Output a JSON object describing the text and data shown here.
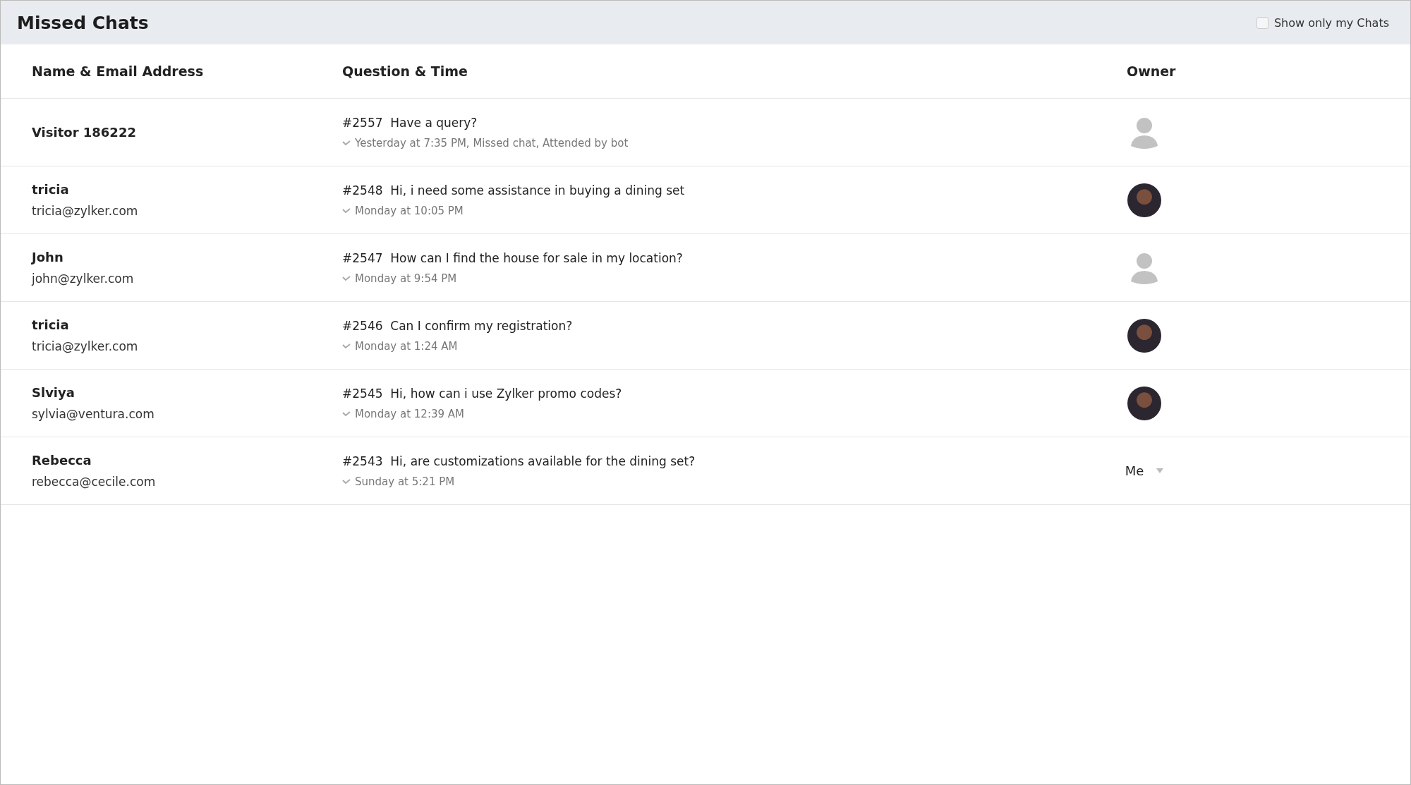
{
  "header": {
    "title": "Missed Chats",
    "filter": {
      "label": "Show only my Chats",
      "checked": false
    }
  },
  "table": {
    "columns": [
      "Name & Email Address",
      "Question & Time",
      "Owner"
    ],
    "rows": [
      {
        "name": "Visitor 186222",
        "id": "#2557",
        "question": "Have a query?",
        "time": "Yesterday at 7:35 PM, Missed chat, Attended by bot",
        "owner": {
          "kind": "silhouette"
        }
      },
      {
        "name": "tricia",
        "email": "tricia@zylker.com",
        "id": "#2548",
        "question": "Hi, i need some assistance in buying a dining set",
        "time": "Monday at 10:05 PM",
        "owner": {
          "kind": "photo"
        }
      },
      {
        "name": "John",
        "email": "john@zylker.com",
        "id": "#2547",
        "question": "How can I find the house for sale in my location?",
        "time": "Monday at 9:54 PM",
        "owner": {
          "kind": "silhouette"
        }
      },
      {
        "name": "tricia",
        "email": "tricia@zylker.com",
        "id": "#2546",
        "question": "Can I confirm my registration?",
        "time": "Monday at 1:24 AM",
        "owner": {
          "kind": "photo"
        }
      },
      {
        "name": "Slviya",
        "email": "sylvia@ventura.com",
        "id": "#2545",
        "question": "Hi, how can i use Zylker promo codes?",
        "time": "Monday at 12:39 AM",
        "owner": {
          "kind": "photo"
        }
      },
      {
        "name": "Rebecca",
        "email": "rebecca@cecile.com",
        "id": "#2543",
        "question": "Hi, are customizations available for the dining set?",
        "time": "Sunday at 5:21 PM",
        "owner": {
          "kind": "dropdown",
          "label": "Me"
        }
      }
    ]
  }
}
